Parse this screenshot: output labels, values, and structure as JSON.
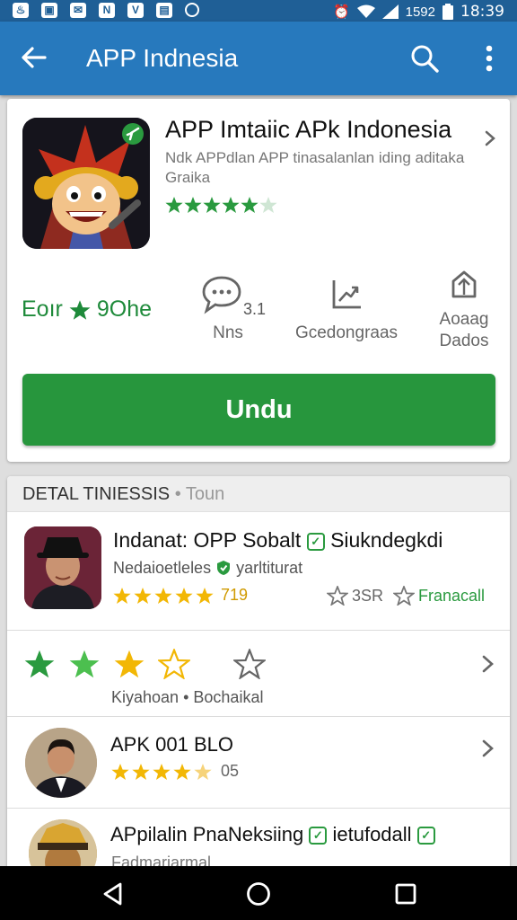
{
  "status_bar": {
    "notification_icons": [
      "flame-icon",
      "screenshot-icon",
      "mail-icon",
      "notes-icon",
      "bookmark-icon",
      "shop-icon",
      "sync-icon"
    ],
    "signal_text": "1592",
    "time": "18:39"
  },
  "app_bar": {
    "title": "APP Indnesia"
  },
  "app_card": {
    "name": "APP Imtaiic APk Indonesia",
    "description": "Ndk APPdlan APP tinasalanlan iding aditaka Graika",
    "rating": 4.5,
    "stats": {
      "rating_label": "Eoır",
      "rating_value": "9Ohe",
      "reviews_count": "3.1",
      "reviews_label": "Nns",
      "downloads_label": "Gcedongraas",
      "share_line1": "Aoaag",
      "share_line2": "Dados"
    },
    "install_button": "Undu"
  },
  "details": {
    "header": "DETAL TINIESSIS",
    "header_sub": "Toun",
    "rows": [
      {
        "title": "Indanat: OPP Sobalt",
        "title_tail": "Siukndegkdi",
        "subtitle": "Nedaioetleles",
        "subtitle_tail": "yarltiturat",
        "rating": 4.5,
        "rating_text": "719",
        "stat_text": "3SR",
        "link_text": "Franacall"
      },
      {
        "stars": [
          "filled-green",
          "filled-green",
          "filled-yellow",
          "outline-yellow",
          "outline-gray"
        ],
        "label": "Kiyahoan",
        "label_sep": "•",
        "label2": "Bochaikal"
      },
      {
        "title": "APK 001 BLO",
        "rating": 4.5,
        "rating_text": "05"
      },
      {
        "title": "APpilalin PnaNeksiing",
        "title_tail": "ietufodall",
        "subtitle": "Fadmariarmal"
      }
    ]
  },
  "colors": {
    "app_bar": "#2779bd",
    "status_bar": "#1f5f96",
    "install_green": "#27963d",
    "star_green": "#2a9a3f",
    "star_yellow": "#f2b705"
  }
}
